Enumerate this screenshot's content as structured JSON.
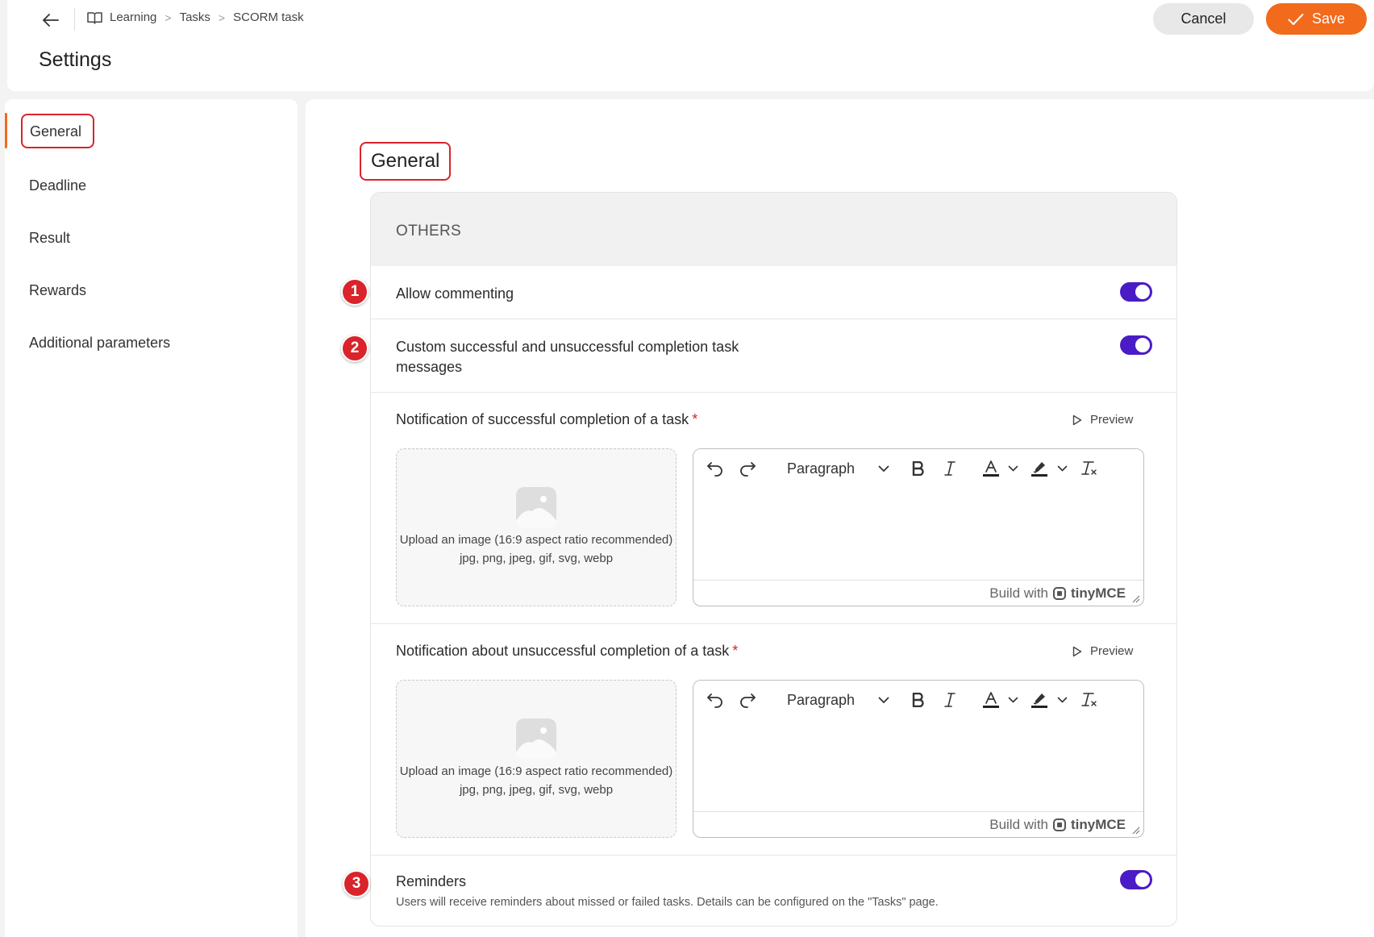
{
  "header": {
    "breadcrumb": [
      "Learning",
      "Tasks",
      "SCORM task"
    ],
    "title": "Settings",
    "cancel_label": "Cancel",
    "save_label": "Save"
  },
  "sidebar": {
    "items": [
      {
        "label": "General",
        "active": true
      },
      {
        "label": "Deadline"
      },
      {
        "label": "Result"
      },
      {
        "label": "Rewards"
      },
      {
        "label": "Additional parameters"
      }
    ]
  },
  "main": {
    "title": "General",
    "section_header": "OTHERS",
    "allow_commenting": {
      "label": "Allow commenting",
      "enabled": true
    },
    "custom_messages": {
      "label_line1": "Custom successful and unsuccessful completion task",
      "label_line2": "messages",
      "enabled": true
    },
    "success_notification": {
      "label": "Notification of successful completion of a task",
      "required_mark": "*",
      "preview_label": "Preview"
    },
    "fail_notification": {
      "label": "Notification about unsuccessful completion of a task",
      "required_mark": "*",
      "preview_label": "Preview"
    },
    "upload": {
      "text": "Upload an image (16:9 aspect ratio recommended)",
      "formats": "jpg, png, jpeg, gif, svg, webp"
    },
    "editor": {
      "block_format": "Paragraph",
      "built_with": "Build with",
      "brand": "tinyMCE"
    },
    "reminders": {
      "label": "Reminders",
      "description": "Users will receive reminders about missed or failed tasks. Details can be configured on the \"Tasks\" page.",
      "enabled": true
    }
  },
  "annotations": [
    "1",
    "2",
    "3"
  ],
  "colors": {
    "accent": "#f26a1b",
    "toggle": "#4a1cc6",
    "annotation": "#d8242a"
  }
}
